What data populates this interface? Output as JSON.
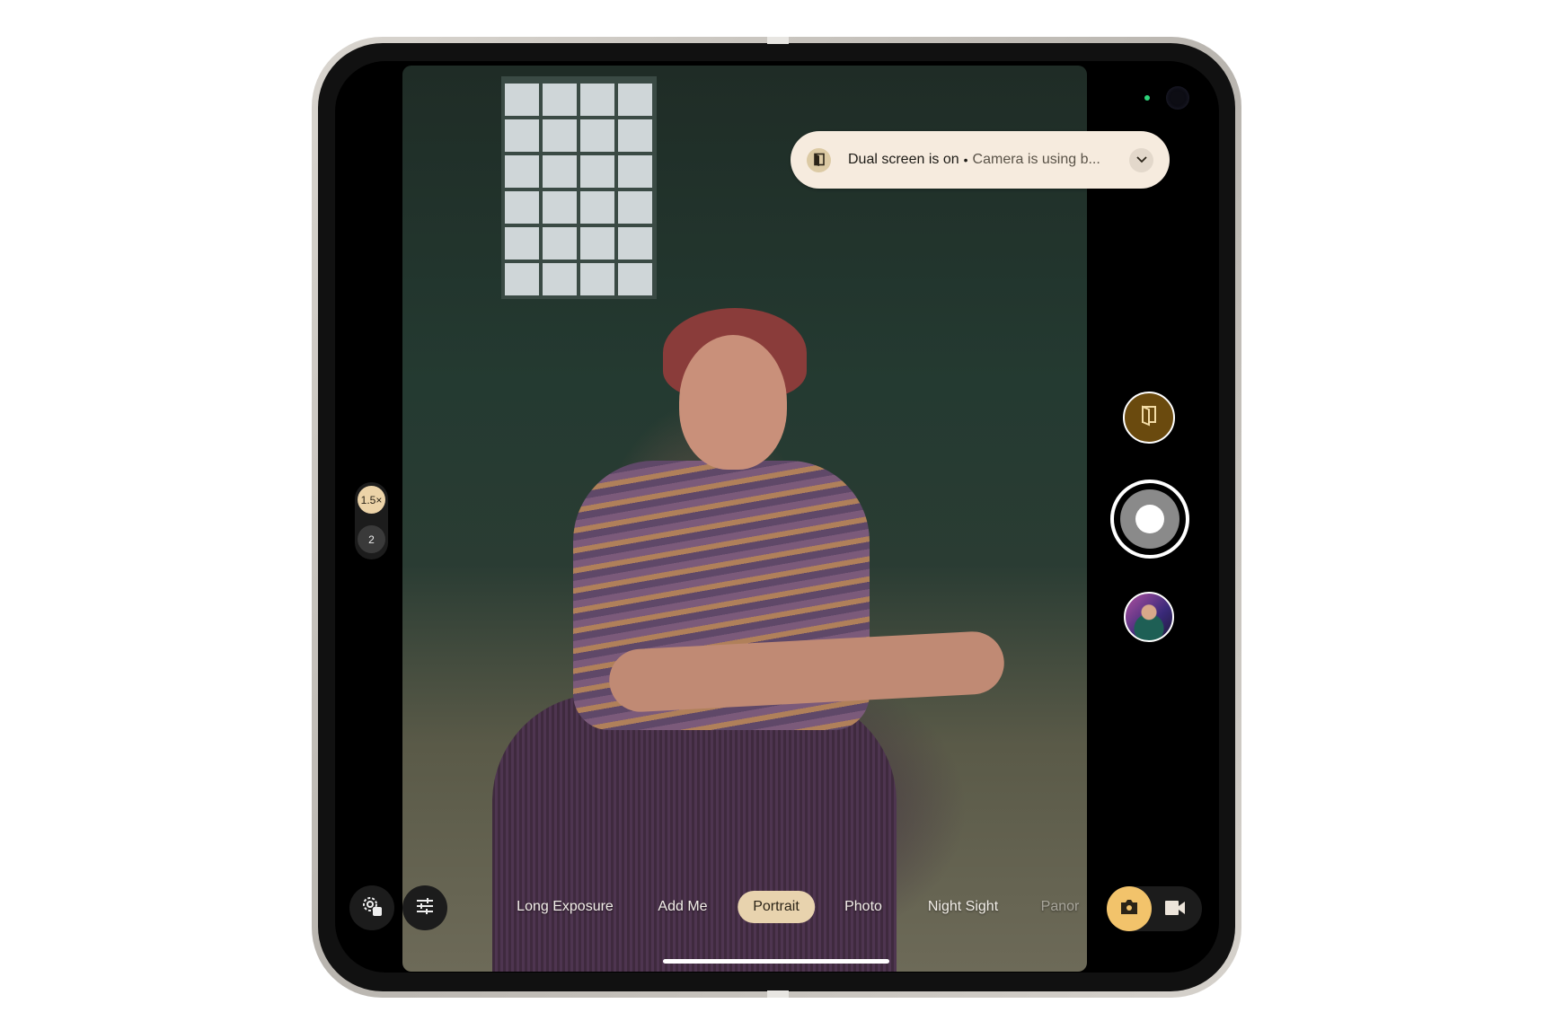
{
  "notification": {
    "title": "Dual screen is on",
    "separator": "•",
    "subtitle": "Camera is using b...",
    "icon": "dual-screen-icon",
    "expand_icon": "chevron-down-icon"
  },
  "zoom": {
    "options": [
      "1.5×",
      "2"
    ],
    "selected": "1.5×"
  },
  "modes": {
    "items": [
      "Long Exposure",
      "Add Me",
      "Portrait",
      "Photo",
      "Night Sight",
      "Panor"
    ],
    "selected": "Portrait"
  },
  "controls": {
    "settings_icon": "settings-gear-icon",
    "adjust_icon": "sliders-icon",
    "dual_screen_icon": "dual-screen-icon",
    "shutter": "shutter-button",
    "gallery": "last-photo-thumbnail",
    "photo_mode_icon": "camera-icon",
    "video_mode_icon": "video-camera-icon"
  },
  "colors": {
    "accent": "#f2c36b",
    "selected_chip": "#e8d3ae",
    "dual_button": "#6a4a0e",
    "notification_bg": "#f6ebde"
  }
}
